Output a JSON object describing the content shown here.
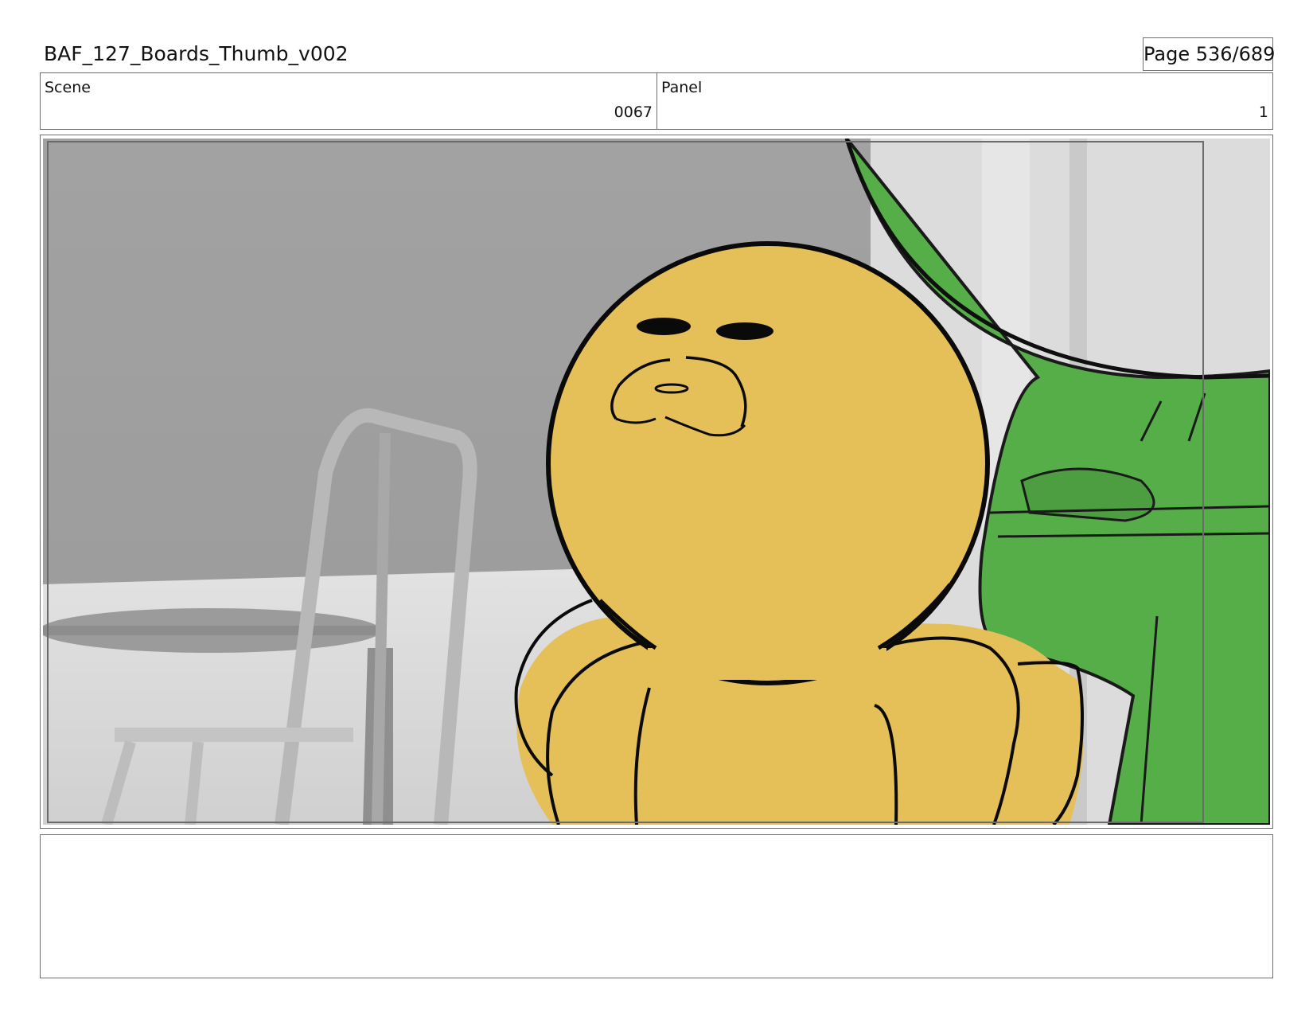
{
  "header": {
    "document_title": "BAF_127_Boards_Thumb_v002",
    "page_indicator": "Page 536/689"
  },
  "info": {
    "scene_label": "Scene",
    "scene_value": "0067",
    "panel_label": "Panel",
    "panel_value": "1"
  },
  "frame": {
    "image_description_none": "",
    "colors": {
      "wall": "#a3a3a3",
      "floor": "#d6d6d6",
      "character_fill": "#e5c058",
      "outline": "#0a0a0a",
      "green_character": "#56ae48"
    }
  },
  "notes": {
    "text": ""
  }
}
